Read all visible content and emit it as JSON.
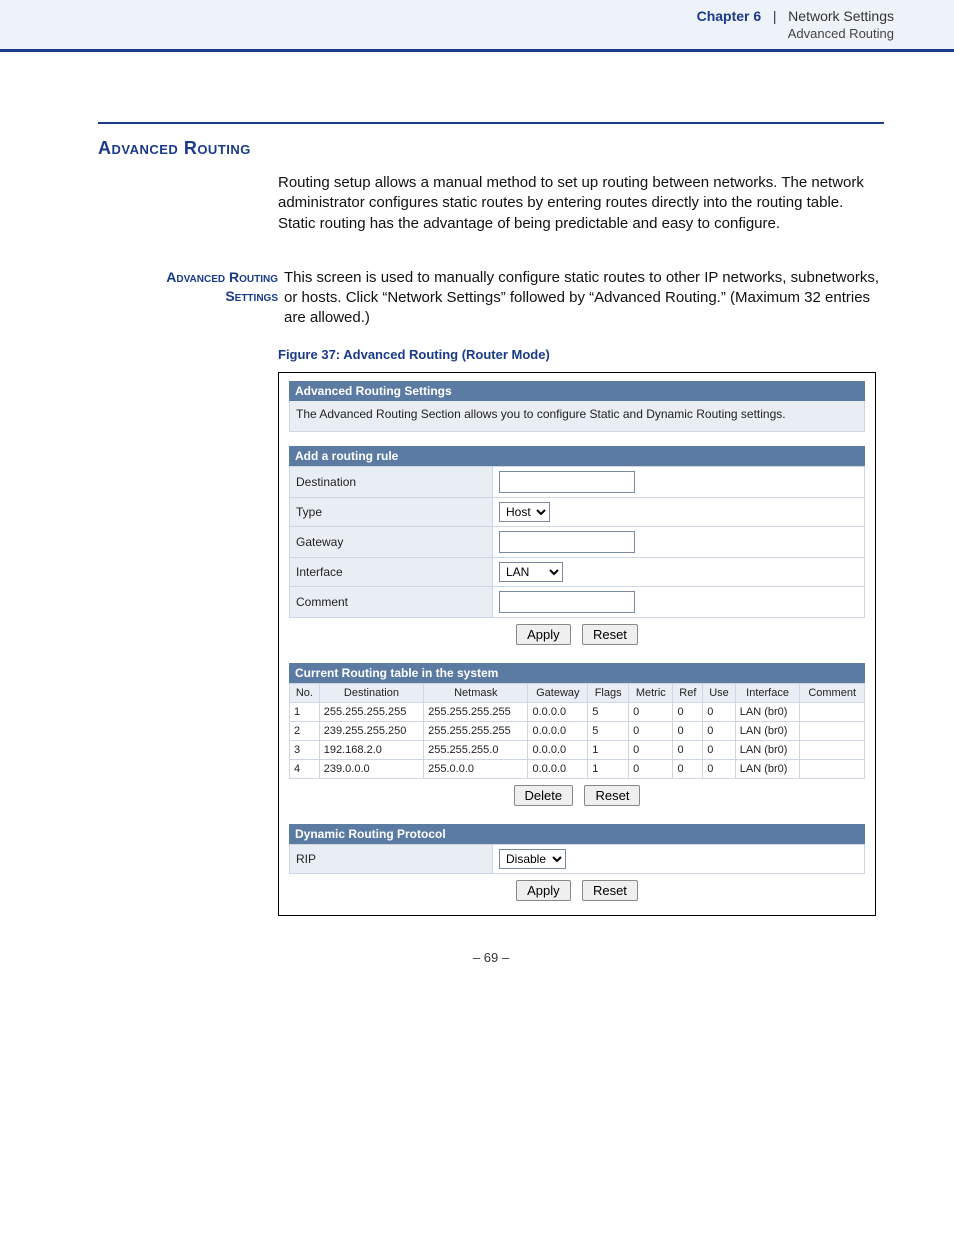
{
  "header": {
    "chapter_label": "Chapter 6",
    "separator": "|",
    "section": "Network Settings",
    "subsection": "Advanced Routing"
  },
  "title": "Advanced Routing",
  "intro": "Routing setup allows a manual method to set up routing between networks. The network administrator configures static routes by entering routes directly into the routing table. Static routing has the advantage of being predictable and easy to configure.",
  "sub_label_line1": "Advanced Routing",
  "sub_label_line2": "Settings",
  "sub_text": "This screen is used to manually configure static routes to other IP networks, subnetworks, or hosts. Click “Network Settings” followed by “Advanced Routing.” (Maximum 32 entries are allowed.)",
  "figure_caption": "Figure 37:  Advanced Routing (Router Mode)",
  "panel1": {
    "title": "Advanced Routing Settings",
    "desc": "The Advanced Routing Section allows you to configure Static and Dynamic Routing settings."
  },
  "panel2": {
    "title": "Add a routing rule",
    "rows": {
      "destination": "Destination",
      "type": "Type",
      "type_value": "Host",
      "gateway": "Gateway",
      "interface": "Interface",
      "interface_value": "LAN",
      "comment": "Comment"
    }
  },
  "buttons": {
    "apply": "Apply",
    "reset": "Reset",
    "delete": "Delete"
  },
  "panel3": {
    "title": "Current Routing table in the system",
    "headers": [
      "No.",
      "Destination",
      "Netmask",
      "Gateway",
      "Flags",
      "Metric",
      "Ref",
      "Use",
      "Interface",
      "Comment"
    ],
    "rows": [
      {
        "no": "1",
        "dest": "255.255.255.255",
        "mask": "255.255.255.255",
        "gw": "0.0.0.0",
        "flags": "5",
        "metric": "0",
        "ref": "0",
        "use": "0",
        "iface": "LAN (br0)",
        "comment": ""
      },
      {
        "no": "2",
        "dest": "239.255.255.250",
        "mask": "255.255.255.255",
        "gw": "0.0.0.0",
        "flags": "5",
        "metric": "0",
        "ref": "0",
        "use": "0",
        "iface": "LAN (br0)",
        "comment": ""
      },
      {
        "no": "3",
        "dest": "192.168.2.0",
        "mask": "255.255.255.0",
        "gw": "0.0.0.0",
        "flags": "1",
        "metric": "0",
        "ref": "0",
        "use": "0",
        "iface": "LAN (br0)",
        "comment": ""
      },
      {
        "no": "4",
        "dest": "239.0.0.0",
        "mask": "255.0.0.0",
        "gw": "0.0.0.0",
        "flags": "1",
        "metric": "0",
        "ref": "0",
        "use": "0",
        "iface": "LAN (br0)",
        "comment": ""
      }
    ]
  },
  "panel4": {
    "title": "Dynamic Routing Protocol",
    "rip_label": "RIP",
    "rip_value": "Disable"
  },
  "pagenum": "–  69  –"
}
